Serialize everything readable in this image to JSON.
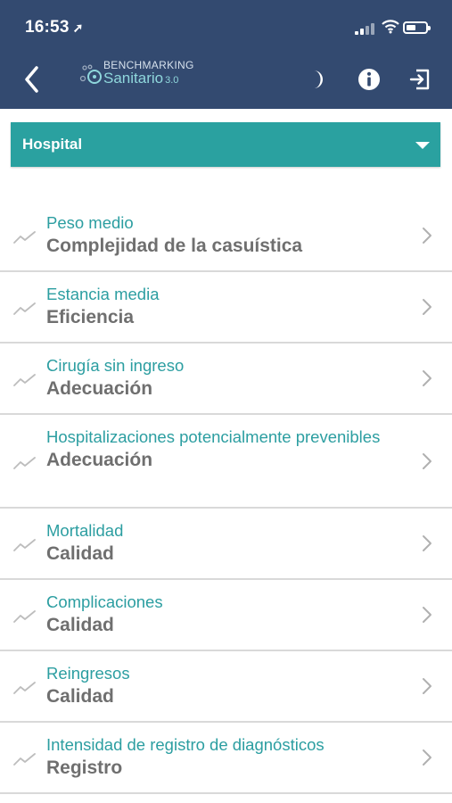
{
  "status_bar": {
    "time": "16:53",
    "location_arrow": "➚"
  },
  "header": {
    "back_icon": "chevron-left-icon",
    "logo_top": "BENCHMARKING",
    "logo_bottom": "Sanitario",
    "logo_version": "3.0",
    "actions": [
      "moon-icon",
      "info-icon",
      "logout-icon"
    ],
    "background_color": "#334a70"
  },
  "hospital_selector": {
    "label": "Hospital",
    "caret": "caret-down-icon",
    "color": "#2aa1a0"
  },
  "indicators": [
    {
      "title": "Peso medio",
      "category": "Complejidad de la casuística"
    },
    {
      "title": "Estancia media",
      "category": "Eficiencia"
    },
    {
      "title": "Cirugía sin ingreso",
      "category": "Adecuación"
    },
    {
      "title": "Hospitalizaciones potencialmente prevenibles",
      "category": "Adecuación"
    },
    {
      "title": "Mortalidad",
      "category": "Calidad"
    },
    {
      "title": "Complicaciones",
      "category": "Calidad"
    },
    {
      "title": "Reingresos",
      "category": "Calidad"
    },
    {
      "title": "Intensidad de registro de diagnósticos",
      "category": "Registro"
    }
  ],
  "colors": {
    "title": "#2c9ea1",
    "category": "#6f6f6f",
    "divider": "#d9d9d9"
  }
}
